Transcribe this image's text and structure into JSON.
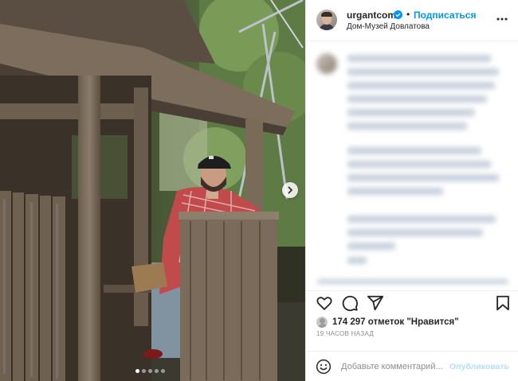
{
  "post": {
    "username": "urgantcom",
    "separator": "•",
    "follow_label": "Подписаться",
    "location": "Дом-Музей Довлатова"
  },
  "actions": {
    "like_icon": "heart-icon",
    "comment_icon": "comment-icon",
    "share_icon": "share-icon",
    "save_icon": "bookmark-icon"
  },
  "likes": {
    "text": "174 297 отметок \"Нравится\""
  },
  "timestamp": "19 ЧАСОВ НАЗАД",
  "comment": {
    "placeholder": "Добавьте комментарий...",
    "publish_label": "Опубликовать"
  },
  "carousel": {
    "slide_count": 5,
    "active_index": 0
  },
  "colors": {
    "accent": "#0095f6",
    "publish_disabled": "#b2dffc",
    "text": "#262626",
    "muted": "#8e8e8e",
    "border": "#efefef"
  }
}
